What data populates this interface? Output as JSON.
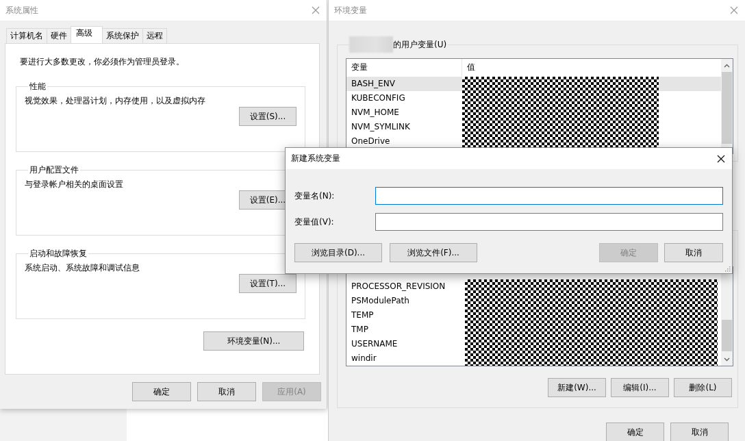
{
  "system_properties": {
    "title": "系统属性",
    "tabs": [
      {
        "label": "计算机名",
        "selected": false
      },
      {
        "label": "硬件",
        "selected": false
      },
      {
        "label": "高级",
        "selected": true
      },
      {
        "label": "系统保护",
        "selected": false
      },
      {
        "label": "远程",
        "selected": false
      }
    ],
    "notice": "要进行大多数更改，你必须作为管理员登录。",
    "groups": [
      {
        "title": "性能",
        "description": "视觉效果，处理器计划，内存使用，以及虚拟内存",
        "button": "设置(S)..."
      },
      {
        "title": "用户配置文件",
        "description": "与登录帐户相关的桌面设置",
        "button": "设置(E)..."
      },
      {
        "title": "启动和故障恢复",
        "description": "系统启动、系统故障和调试信息",
        "button": "设置(T)..."
      }
    ],
    "env_button": "环境变量(N)...",
    "buttons": [
      {
        "label": "确定",
        "disabled": false
      },
      {
        "label": "取消",
        "disabled": false
      },
      {
        "label": "应用(A)",
        "disabled": true
      }
    ]
  },
  "environment_variables": {
    "title": "环境变量",
    "user_group": {
      "label": "的用户变量(U)",
      "columns": [
        "变量",
        "值"
      ],
      "rows": [
        {
          "name": "BASH_ENV",
          "selected": true
        },
        {
          "name": "KUBECONFIG",
          "selected": false
        },
        {
          "name": "NVM_HOME",
          "selected": false
        },
        {
          "name": "NVM_SYMLINK",
          "selected": false
        },
        {
          "name": "OneDrive",
          "selected": false
        }
      ]
    },
    "system_group": {
      "rows": [
        {
          "name": "PROCESSOR_REVISION",
          "selected": false
        },
        {
          "name": "PSModulePath",
          "selected": false
        },
        {
          "name": "TEMP",
          "selected": false
        },
        {
          "name": "TMP",
          "selected": false
        },
        {
          "name": "USERNAME",
          "selected": false
        },
        {
          "name": "windir",
          "selected": false
        }
      ],
      "buttons": [
        "新建(W)...",
        "编辑(I)...",
        "删除(L)"
      ]
    },
    "buttons": [
      "确定",
      "取消"
    ]
  },
  "new_variable_dialog": {
    "title": "新建系统变量",
    "fields": [
      {
        "label": "变量名(N):",
        "focused": true
      },
      {
        "label": "变量值(V):",
        "focused": false
      }
    ],
    "browse_buttons": [
      "浏览目录(D)...",
      "浏览文件(F)..."
    ],
    "buttons": [
      {
        "label": "确定",
        "disabled": true
      },
      {
        "label": "取消",
        "disabled": false
      }
    ]
  }
}
